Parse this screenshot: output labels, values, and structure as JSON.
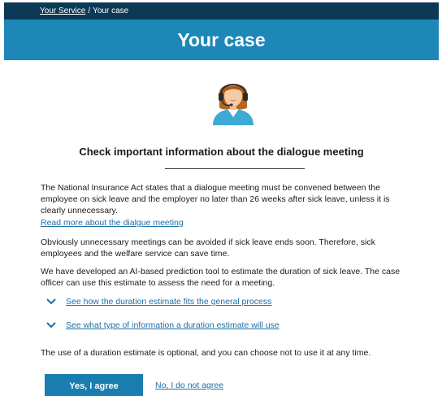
{
  "breadcrumb": {
    "home": "Your Service",
    "separator": "/",
    "current": "Your case"
  },
  "header": {
    "title": "Your case"
  },
  "main": {
    "heading": "Check important information about the dialogue meeting",
    "paragraph1": "The National Insurance Act states that a dialogue meeting must be convened between the employee on sick leave and the employer no later than 26 weeks after sick leave, unless it is clearly unnecessary.",
    "read_more_link": "Read more about the dialgue meeting",
    "paragraph2": "Obviously unnecessary meetings can be avoided if sick leave ends soon. Therefore, sick employees and the welfare service can save time.",
    "paragraph3": "We have developed an AI-based prediction tool to estimate the duration of sick leave. The case officer can use this estimate to assess the need for a meeting.",
    "expanders": [
      {
        "label": "See how the duration estimate fits the general process",
        "icon": "chevron-down-icon"
      },
      {
        "label": "See what type of information a duration estimate will use",
        "icon": "chevron-down-icon"
      }
    ],
    "paragraph4": "The use of a duration estimate is optional, and you can choose not to use it at any time.",
    "agree_button": "Yes, I agree",
    "decline_link": "No, I do not agree"
  },
  "colors": {
    "breadcrumb_bar": "#0c3a55",
    "title_bar": "#1d87b8",
    "link": "#1d6fa5",
    "button": "#1a7db0"
  }
}
